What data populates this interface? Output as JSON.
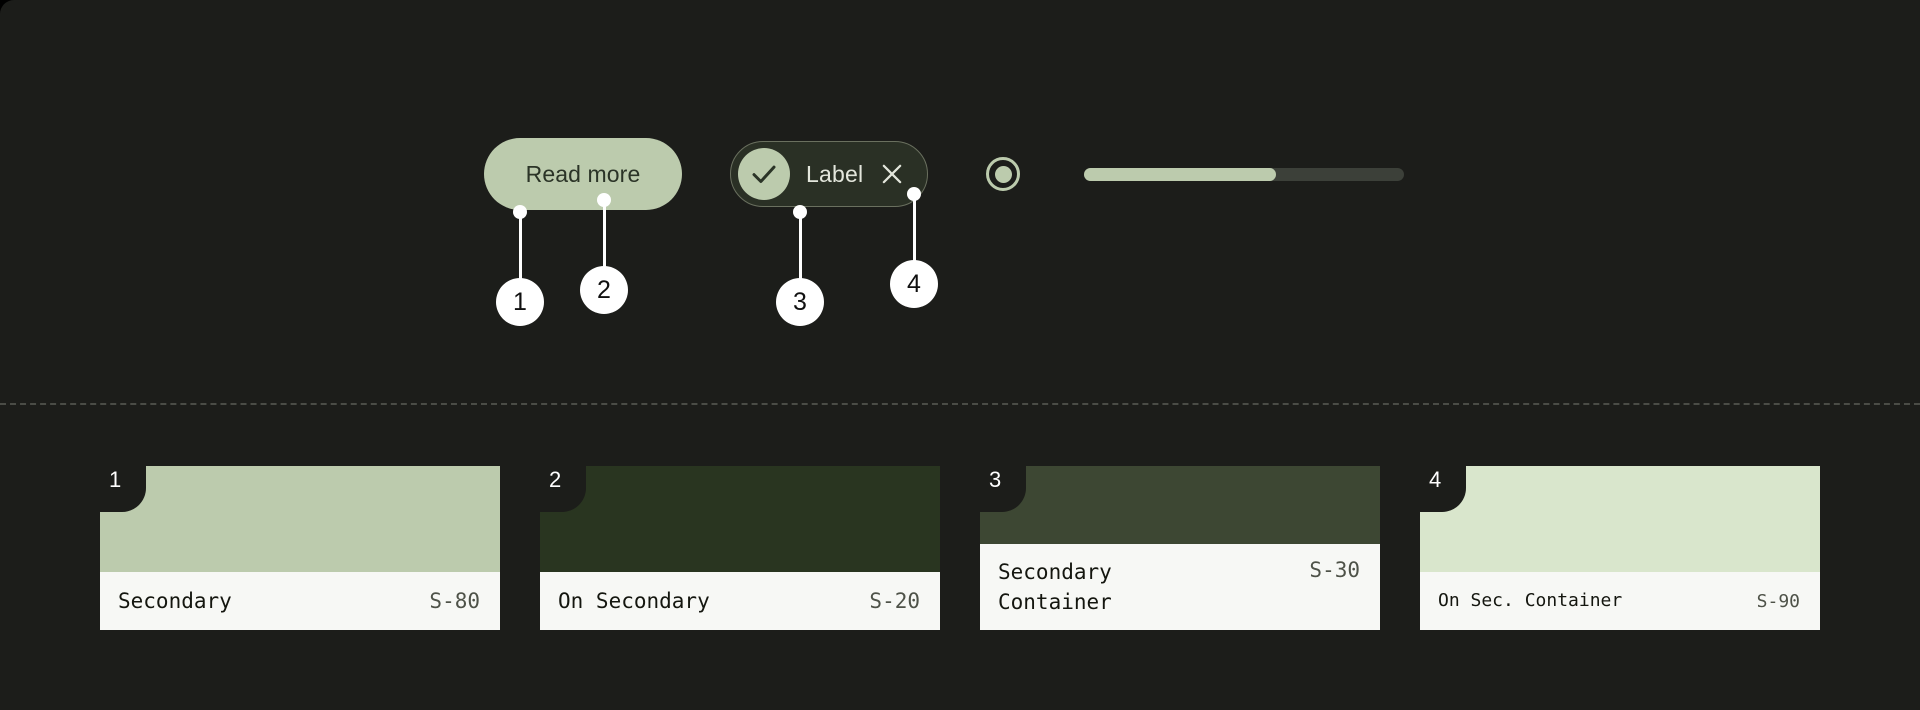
{
  "theme": {
    "canvas_bg": "#1c1d1a",
    "accent": "#bccbad",
    "on_accent": "#2b3427",
    "callout_color": "#ffffff",
    "card_bg": "#f7f8f5",
    "divider_color": "#4a4c46"
  },
  "showcase": {
    "button": {
      "label": "Read more",
      "bg": "#bccbad",
      "text_color": "#2b3427"
    },
    "chip": {
      "label": "Label",
      "bg": "#2a3025",
      "border_color": "#6a705f",
      "avatar_bg": "#bccbad",
      "check_icon": "check-icon",
      "close_icon": "close-icon"
    },
    "radio": {
      "icon": "radio-selected-icon",
      "selected": true,
      "color": "#bccbad"
    },
    "slider": {
      "icon": "slider-track",
      "value_percent": 60,
      "active_color": "#bccbad",
      "inactive_color": "#3c4039"
    }
  },
  "callouts": [
    {
      "number": "1",
      "target": "button-container"
    },
    {
      "number": "2",
      "target": "button-label"
    },
    {
      "number": "3",
      "target": "chip-container"
    },
    {
      "number": "4",
      "target": "chip-close-icon"
    }
  ],
  "cards": [
    {
      "badge": "1",
      "name": "Secondary",
      "token": "S-80",
      "swatch": "#bccbad",
      "lines": 1,
      "small": false
    },
    {
      "badge": "2",
      "name": "On Secondary",
      "token": "S-20",
      "swatch": "#293520",
      "lines": 1,
      "small": false
    },
    {
      "badge": "3",
      "name": "Secondary\nContainer",
      "token": "S-30",
      "swatch": "#3d4733",
      "lines": 2,
      "small": false
    },
    {
      "badge": "4",
      "name": "On Sec. Container",
      "token": "S-90",
      "swatch": "#d9e6cc",
      "lines": 1,
      "small": true
    }
  ]
}
